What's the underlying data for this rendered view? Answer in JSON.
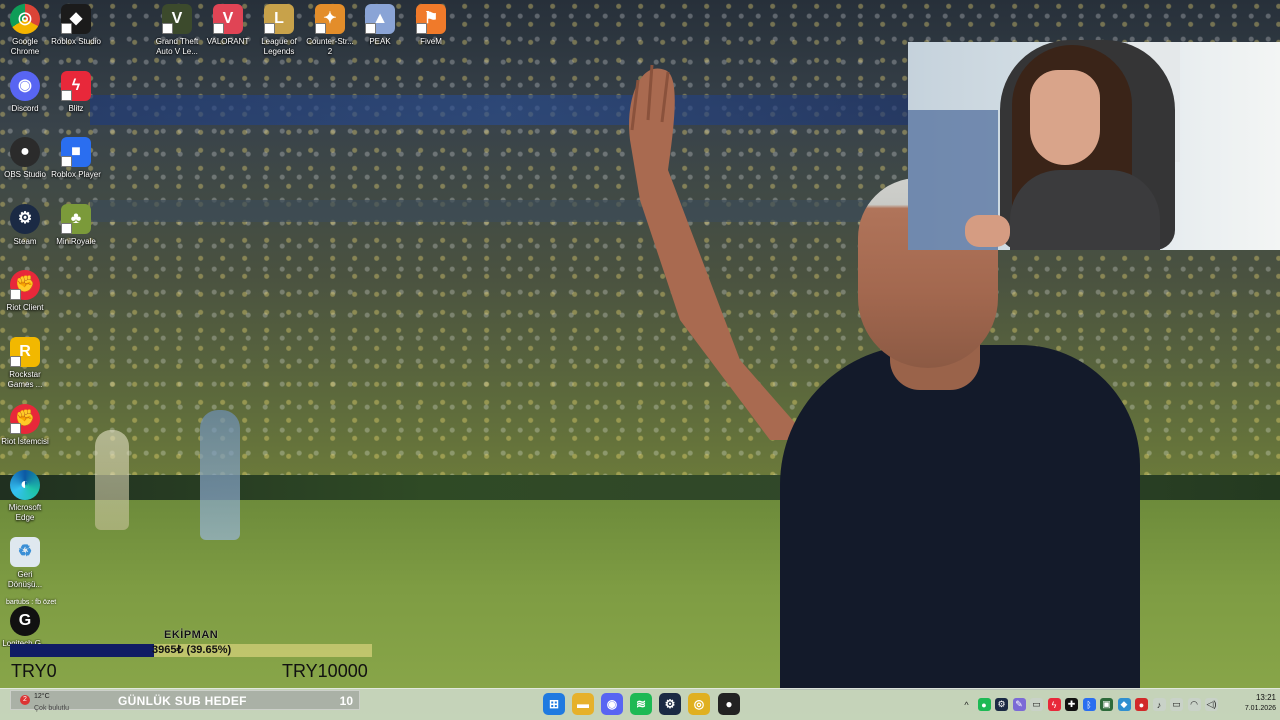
{
  "desktop_icons": [
    {
      "label": "Google Chrome",
      "icon": "chrome-icon",
      "color": "#e0b020"
    },
    {
      "label": "Roblox Studio",
      "icon": "roblox-studio-icon",
      "color": "#1b1b1b"
    },
    {
      "label": "Grand Theft Auto V Le...",
      "icon": "gta-icon",
      "color": "#3c4a2c"
    },
    {
      "label": "VALORANT",
      "icon": "valorant-icon",
      "color": "#e04455"
    },
    {
      "label": "League of Legends",
      "icon": "league-icon",
      "color": "#c8a24a"
    },
    {
      "label": "Counter-Str... 2",
      "icon": "cs2-icon",
      "color": "#e38d2a"
    },
    {
      "label": "PEAK",
      "icon": "peak-icon",
      "color": "#8aa4d6"
    },
    {
      "label": "FiveM",
      "icon": "fivem-icon",
      "color": "#f07a2a"
    },
    {
      "label": "Discord",
      "icon": "discord-icon",
      "color": "#5865f2"
    },
    {
      "label": "Blitz",
      "icon": "blitz-icon",
      "color": "#e8283a"
    },
    {
      "label": "OBS Studio",
      "icon": "obs-icon",
      "color": "#2b2b2b"
    },
    {
      "label": "Roblox Player",
      "icon": "roblox-player-icon",
      "color": "#2a6ef0"
    },
    {
      "label": "Steam",
      "icon": "steam-icon",
      "color": "#1b2a44"
    },
    {
      "label": "MiniRoyale",
      "icon": "miniroyale-icon",
      "color": "#7b9a3a"
    },
    {
      "label": "Riot Client",
      "icon": "riot-client-icon",
      "color": "#e8283a"
    },
    {
      "label": "Rockstar Games ...",
      "icon": "rockstar-icon",
      "color": "#f2b800"
    },
    {
      "label": "Riot İstemcisi",
      "icon": "riot-istemcisi-icon",
      "color": "#e8283a"
    },
    {
      "label": "Microsoft Edge",
      "icon": "edge-icon",
      "color": "#1a9ad6"
    },
    {
      "label": "Geri Dönüşü...",
      "icon": "recycle-bin-icon",
      "color": "#dfe8ef"
    },
    {
      "label": "Logitech G...",
      "icon": "logitech-g-icon",
      "color": "#111111"
    }
  ],
  "overlay_caption": "bartubs : fb özet",
  "goal": {
    "label": "EKİPMAN",
    "amount_text": "3965₺ (39.65%)",
    "progress_percent": 39.65,
    "min_text": "TRY0",
    "max_text": "TRY10000",
    "fill_color": "#101c64"
  },
  "sub_goal": {
    "label": "GÜNLÜK SUB HEDEF",
    "count": "10"
  },
  "weather": {
    "badge": "2",
    "temp": "12°C",
    "desc": "Çok bulutlu"
  },
  "taskbar_apps": [
    {
      "name": "start-button",
      "icon": "windows-icon",
      "glyph": "⊞",
      "color": "#1f7ae0"
    },
    {
      "name": "file-explorer",
      "icon": "folder-icon",
      "glyph": "▬",
      "color": "#e6b12a"
    },
    {
      "name": "discord",
      "icon": "discord-icon",
      "glyph": "◉",
      "color": "#5865f2"
    },
    {
      "name": "spotify",
      "icon": "spotify-icon",
      "glyph": "≋",
      "color": "#1db954"
    },
    {
      "name": "steam",
      "icon": "steam-icon",
      "glyph": "⚙",
      "color": "#1b2a44"
    },
    {
      "name": "chrome",
      "icon": "chrome-icon",
      "glyph": "◎",
      "color": "#e0b020"
    },
    {
      "name": "obs",
      "icon": "obs-icon",
      "glyph": "●",
      "color": "#222222"
    }
  ],
  "tray_icons": [
    "chevron-up-icon",
    "green-app-icon",
    "steam-tray-icon",
    "pen-icon",
    "car-icon",
    "blitz-tray-icon",
    "crosshair-icon",
    "bluetooth-icon",
    "monitor-icon",
    "shield-icon",
    "record-icon",
    "mic-icon",
    "network-icon",
    "wifi-icon",
    "volume-icon"
  ],
  "clock": {
    "time": "13:21",
    "date": "7.01.2026"
  }
}
